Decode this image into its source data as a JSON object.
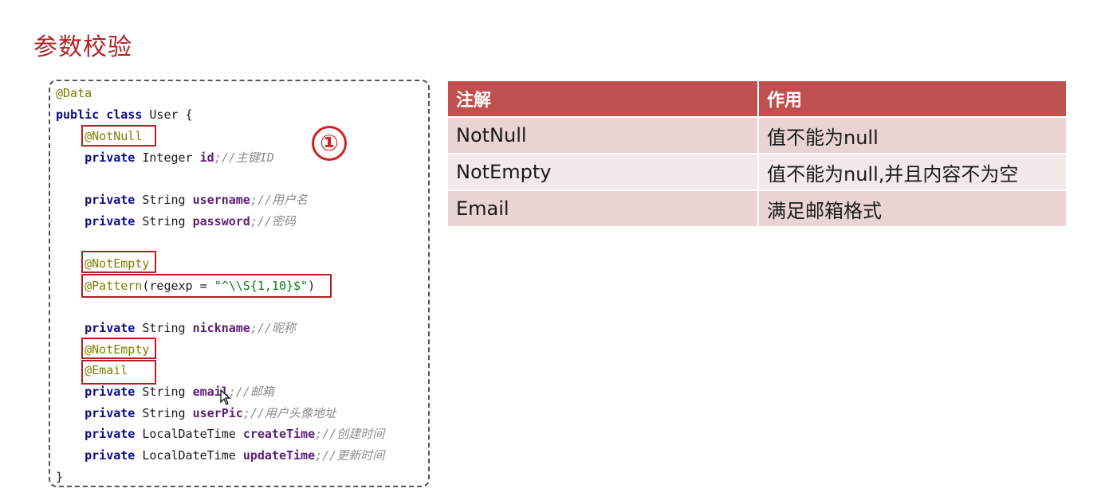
{
  "page_title": "参数校验",
  "marker": "①",
  "code": {
    "l1": "@Data",
    "l2_kw": "public class",
    "l2_name": " User {",
    "ann_notnull": "@NotNull",
    "id_kw": "private",
    "id_type": " Integer ",
    "id_field": "id",
    "id_cmt": ";//主键ID",
    "un_kw": "private",
    "un_type": " String ",
    "un_field": "username",
    "un_cmt": ";//用户名",
    "pw_kw": "private",
    "pw_type": " String ",
    "pw_field": "password",
    "pw_cmt": ";//密码",
    "ann_notempty_1": "@NotEmpty",
    "pattern_ann": "@Pattern",
    "pattern_args": "(regexp = ",
    "pattern_str": "\"^\\\\S{1,10}$\"",
    "pattern_close": ")",
    "nn_kw": "private",
    "nn_type": " String ",
    "nn_field": "nickname",
    "nn_cmt": ";//昵称",
    "ann_notempty_2": "@NotEmpty",
    "ann_email": "@Email",
    "em_kw": "private",
    "em_type": " String ",
    "em_field": "email",
    "em_cmt": ";//邮箱",
    "up_kw": "private",
    "up_type": " String ",
    "up_field": "userPic",
    "up_cmt": ";//用户头像地址",
    "ct_kw": "private",
    "ct_type": " LocalDateTime ",
    "ct_field": "createTime",
    "ct_cmt": ";//创建时间",
    "ut_kw": "private",
    "ut_type": " LocalDateTime ",
    "ut_field": "updateTime",
    "ut_cmt": ";//更新时间",
    "close": "}"
  },
  "table": {
    "headers": [
      "注解",
      "作用"
    ],
    "rows": [
      [
        "NotNull",
        "值不能为null"
      ],
      [
        "NotEmpty",
        "值不能为null,并且内容不为空"
      ],
      [
        "Email",
        "满足邮箱格式"
      ]
    ]
  },
  "colors": {
    "accent": "#b22222",
    "table_header": "#c0504d",
    "row_a": "#e9d3d3",
    "row_b": "#f3e9e9"
  }
}
